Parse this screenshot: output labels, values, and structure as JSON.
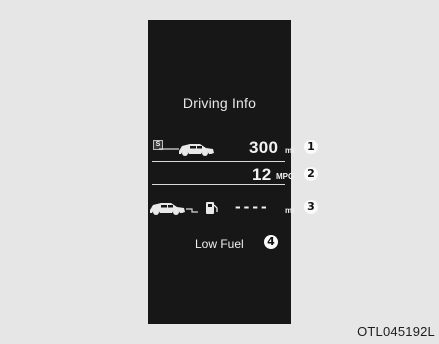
{
  "screen": {
    "title": "Driving Info",
    "rows": [
      {
        "tag": "S",
        "value": "300",
        "unit": "mi",
        "callout": "1"
      },
      {
        "value": "12",
        "unit": "MPG",
        "callout": "2"
      },
      {
        "value": "----",
        "unit": "mi",
        "callout": "3"
      }
    ],
    "warning": {
      "label": "Low Fuel",
      "callout": "4"
    }
  },
  "figure_code": "OTL045192L",
  "colors": {
    "background": "#e6e6e6",
    "screen": "#171717",
    "text": "#f2f2f2"
  },
  "icons": {
    "car": "car-icon",
    "fuel": "fuel-pump-icon"
  }
}
